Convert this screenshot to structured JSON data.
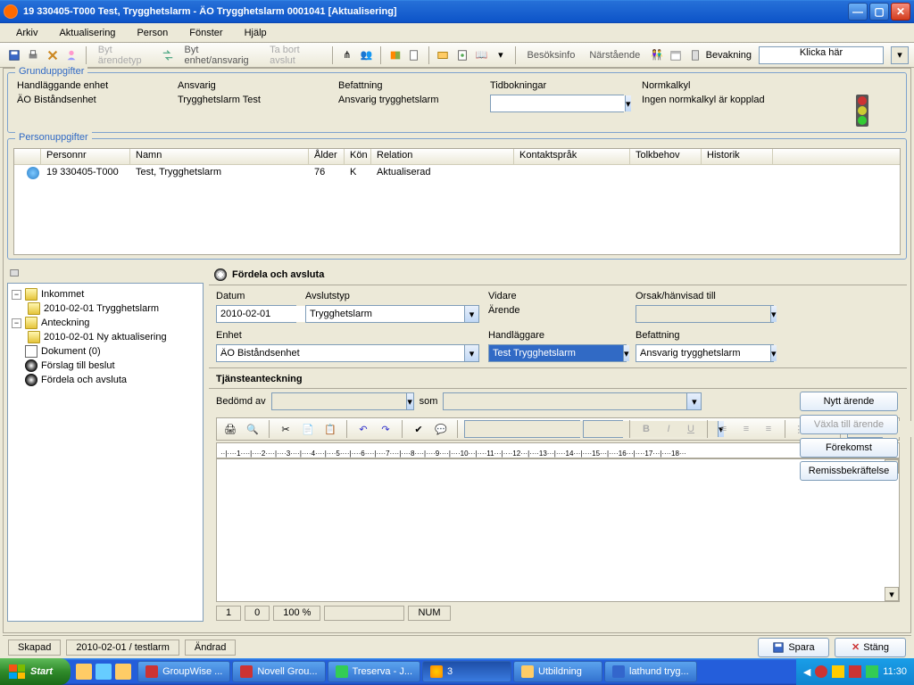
{
  "window": {
    "title": "19 330405-T000  Test, Trygghetslarm  -   ÄO Trygghetslarm   0001041   [Aktualisering]"
  },
  "menu": {
    "arkiv": "Arkiv",
    "aktualisering": "Aktualisering",
    "person": "Person",
    "fonster": "Fönster",
    "hjalp": "Hjälp"
  },
  "toolbar": {
    "byt_arendetyp": "Byt ärendetyp",
    "byt_enhet": "Byt enhet/ansvarig",
    "ta_bort_avslut": "Ta bort avslut",
    "besoksinfo": "Besöksinfo",
    "narstaende": "Närstående",
    "bevakning": "Bevakning",
    "klicka_har": "Klicka här"
  },
  "grund": {
    "legend": "Grunduppgifter",
    "handlaggande_label": "Handläggande enhet",
    "handlaggande_value": "ÄO Biståndsenhet",
    "ansvarig_label": "Ansvarig",
    "ansvarig_value": "Trygghetslarm Test",
    "befattning_label": "Befattning",
    "befattning_value": "Ansvarig trygghetslarm",
    "tidbokningar_label": "Tidbokningar",
    "normkalkyl_label": "Normkalkyl",
    "normkalkyl_value": "Ingen normkalkyl är kopplad"
  },
  "person": {
    "legend": "Personuppgifter",
    "cols": {
      "personnr": "Personnr",
      "namn": "Namn",
      "alder": "Ålder",
      "kon": "Kön",
      "relation": "Relation",
      "kontaktsprak": "Kontaktspråk",
      "tolkbehov": "Tolkbehov",
      "historik": "Historik"
    },
    "row": {
      "personnr": "19 330405-T000",
      "namn": "Test, Trygghetslarm",
      "alder": "76",
      "kon": "K",
      "relation": "Aktualiserad"
    }
  },
  "tree": {
    "inkommet": "Inkommet",
    "inkommet_child": "2010-02-01 Trygghetslarm",
    "anteckning": "Anteckning",
    "anteckning_child": "2010-02-01 Ny aktualisering",
    "dokument": "Dokument (0)",
    "forslag": "Förslag till beslut",
    "fordela": "Fördela och avsluta"
  },
  "fordela": {
    "header": "Fördela och avsluta",
    "datum_label": "Datum",
    "datum_value": "2010-02-01",
    "avslutstyp_label": "Avslutstyp",
    "avslutstyp_value": "Trygghetslarm",
    "vidare_label": "Vidare",
    "vidare_value": "Ärende",
    "orsak_label": "Orsak/hänvisad till",
    "enhet_label": "Enhet",
    "enhet_value": "ÄO Biståndsenhet",
    "handlaggare_label": "Handläggare",
    "handlaggare_value": "Test Trygghetslarm",
    "befattning_label": "Befattning",
    "befattning_value": "Ansvarig trygghetslarm"
  },
  "buttons": {
    "nytt_arende": "Nytt ärende",
    "vaxla": "Växla till ärende",
    "forekomst": "Förekomst",
    "remiss": "Remissbekräftelse",
    "spara": "Spara",
    "stang": "Stäng"
  },
  "tja": {
    "header": "Tjänsteanteckning",
    "bedomd_av": "Bedömd av",
    "som": "som"
  },
  "editor_status": {
    "page": "1",
    "col": "0",
    "zoom": "100 %",
    "num": "NUM"
  },
  "status": {
    "skapad": "Skapad",
    "skapad_val": "2010-02-01 / testlarm",
    "andrad": "Ändrad"
  },
  "taskbar": {
    "start": "Start",
    "t1": "GroupWise ...",
    "t2": "Novell Grou...",
    "t3": "Treserva - J...",
    "t4": "3",
    "t5": "Utbildning",
    "t6": "lathund tryg...",
    "time": "11:30"
  }
}
